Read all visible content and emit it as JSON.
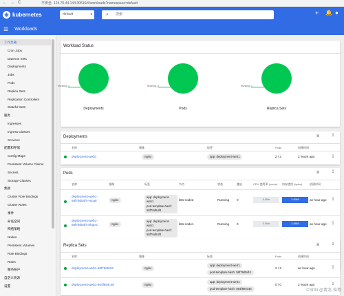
{
  "browser": {
    "back": "←",
    "forward": "→",
    "reload": "C",
    "security": "不安全",
    "url": "124.70.44.144:30516/#/workloads?namespace=default"
  },
  "topbar": {
    "logo_text": "kubernetes",
    "namespace": "default",
    "search_placeholder": "搜索",
    "icons": [
      "add-icon",
      "notifications-icon",
      "account-icon"
    ]
  },
  "header": {
    "menu_icon": "☰",
    "title": "Workloads"
  },
  "sidebar": {
    "items": [
      {
        "label": "工作负载",
        "type": "header",
        "active": true
      },
      {
        "label": "Cron Jobs",
        "type": "item"
      },
      {
        "label": "Daemon Sets",
        "type": "item"
      },
      {
        "label": "Deployments",
        "type": "item"
      },
      {
        "label": "Jobs",
        "type": "item"
      },
      {
        "label": "Pods",
        "type": "item"
      },
      {
        "label": "Replica Sets",
        "type": "item"
      },
      {
        "label": "Replication Controllers",
        "type": "item"
      },
      {
        "label": "Stateful Sets",
        "type": "item"
      },
      {
        "label": "服务",
        "type": "header"
      },
      {
        "label": "Ingresses",
        "type": "item"
      },
      {
        "label": "Ingress Classes",
        "type": "item"
      },
      {
        "label": "Services",
        "type": "item"
      },
      {
        "label": "配置和存储",
        "type": "header"
      },
      {
        "label": "Config Maps",
        "type": "item"
      },
      {
        "label": "Persistent Volume Claims",
        "type": "item"
      },
      {
        "label": "Secrets",
        "type": "item"
      },
      {
        "label": "Storage Classes",
        "type": "item"
      },
      {
        "label": "集群",
        "type": "header"
      },
      {
        "label": "Cluster Role Bindings",
        "type": "item"
      },
      {
        "label": "Cluster Roles",
        "type": "item"
      },
      {
        "label": "事件",
        "type": "item"
      },
      {
        "label": "命名空间",
        "type": "item"
      },
      {
        "label": "网络策略",
        "type": "item"
      },
      {
        "label": "Nodes",
        "type": "item"
      },
      {
        "label": "Persistent Volumes",
        "type": "item"
      },
      {
        "label": "Role Bindings",
        "type": "item"
      },
      {
        "label": "Roles",
        "type": "item"
      },
      {
        "label": "服务帐户",
        "type": "item"
      },
      {
        "label": "自定义资源",
        "type": "header"
      },
      {
        "label": "设置",
        "type": "header"
      }
    ]
  },
  "workload_status": {
    "title": "Workload Status",
    "charts": [
      {
        "label": "Deployments",
        "legend": "Running: 1",
        "running": 1
      },
      {
        "label": "Pods",
        "legend": "Running: 2",
        "running": 2
      },
      {
        "label": "Replica Sets",
        "legend": "Running: 1",
        "running": 1
      }
    ]
  },
  "deployments": {
    "title": "Deployments",
    "headers": [
      "名称",
      "镜像",
      "标签",
      "Pods",
      "创建时间"
    ],
    "rows": [
      {
        "name": "deployment-web1",
        "image": "nginx",
        "label": "app: deployment-web1",
        "pods": "2 / 2",
        "created": "2 hours ago"
      }
    ]
  },
  "pods": {
    "title": "Pods",
    "headers": [
      "名称",
      "镜像",
      "标签",
      "节点",
      "状态",
      "重启",
      "CPU 使用率 (cores)",
      "内存使用 (bytes)",
      "创建时间"
    ],
    "rows": [
      {
        "name": "deployment-web1-58f76d54f4-vscg8",
        "image": "nginx",
        "labels": [
          "app: deployment-web1",
          "pod-template-hash: 58f76d54f4"
        ],
        "node": "k8s-node2",
        "status": "Running",
        "restarts": "0",
        "cpu": "0.00m",
        "memory": "2.90Mi",
        "created": "an hour ago"
      },
      {
        "name": "deployment-web1-58f76d54f4-bhgmc",
        "image": "nginx",
        "labels": [
          "app: deployment-web1",
          "pod-template-hash: 58f76d54f4"
        ],
        "node": "k8s-node1",
        "status": "Running",
        "restarts": "0",
        "cpu": "0.00m",
        "memory": "2.88Mi",
        "created": "an hour ago"
      }
    ]
  },
  "replica_sets": {
    "title": "Replica Sets",
    "headers": [
      "名称",
      "镜像",
      "标签",
      "Pods",
      "创建时间"
    ],
    "rows": [
      {
        "name": "deployment-web1-58f76d54f4",
        "image": "nginx",
        "labels": [
          "app: deployment-web1",
          "pod-template-hash: 58f76d54f4"
        ],
        "pods": "2 / 2",
        "created": "an hour ago"
      },
      {
        "name": "deployment-web1-564f894c46",
        "image": "nginx",
        "labels": [
          "app: deployment-web1",
          "pod-template-hash: 564f894c46"
        ],
        "pods": "0 / 0",
        "created": "2 hours ago"
      }
    ]
  },
  "watermark": "CSDN @青龙-仙尊",
  "colors": {
    "primary": "#326ce5",
    "success": "#00c752"
  }
}
